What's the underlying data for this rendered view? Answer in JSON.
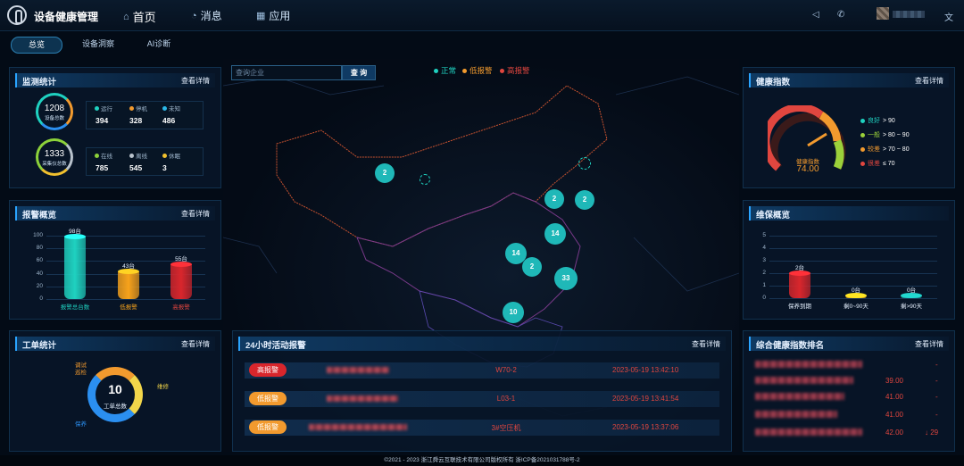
{
  "app": {
    "title": "设备健康管理"
  },
  "topnav": [
    {
      "label": "首页",
      "icon": "home-icon",
      "glyph": "⌂"
    },
    {
      "label": "消息",
      "icon": "message-icon",
      "glyph": "◔"
    },
    {
      "label": "应用",
      "icon": "apps-icon",
      "glyph": "▦"
    }
  ],
  "subtabs": [
    "总览",
    "设备洞察",
    "AI诊断"
  ],
  "monitor": {
    "title": "监测统计",
    "more": "查看详情",
    "device_total": {
      "value": "1208",
      "label": "设备总数"
    },
    "collector_total": {
      "value": "1333",
      "label": "采集仪总数"
    },
    "run_states": [
      {
        "label": "运行",
        "value": "394",
        "color": "#1fd1c0"
      },
      {
        "label": "停机",
        "value": "328",
        "color": "#f29a2e"
      },
      {
        "label": "未知",
        "value": "486",
        "color": "#2bb8e8"
      }
    ],
    "online_states": [
      {
        "label": "在线",
        "value": "785",
        "color": "#8cd13a"
      },
      {
        "label": "离线",
        "value": "545",
        "color": "#b8c2cc"
      },
      {
        "label": "休眠",
        "value": "3",
        "color": "#f2c12e"
      }
    ]
  },
  "alarm_overview": {
    "title": "报警概览",
    "more": "查看详情",
    "y_ticks": [
      "100",
      "80",
      "60",
      "40",
      "20",
      "0"
    ],
    "bars": [
      {
        "label": "报警总台数",
        "value": 98,
        "value_label": "98台",
        "color": "#1fd1c0",
        "label_color": "#1fd1c0"
      },
      {
        "label": "低报警",
        "value": 43,
        "value_label": "43台",
        "color": "#f7a21b",
        "label_color": "#f7a21b"
      },
      {
        "label": "高报警",
        "value": 55,
        "value_label": "55台",
        "color": "#d9262c",
        "label_color": "#e0463f"
      }
    ]
  },
  "workorder": {
    "title": "工单统计",
    "more": "查看详情",
    "center_value": "10",
    "center_label": "工单总数",
    "labels": [
      {
        "text": "调试",
        "color": "#f29a2e"
      },
      {
        "text": "巡检",
        "color": "#f29a2e"
      },
      {
        "text": "维修",
        "color": "#f2d64a"
      },
      {
        "text": "保养",
        "color": "#2b8ff0"
      }
    ]
  },
  "map": {
    "search_placeholder": "查询企业",
    "search_button": "查 询",
    "legend": [
      {
        "label": "正常",
        "color": "#1fd1c0"
      },
      {
        "label": "低报警",
        "color": "#f29a2e"
      },
      {
        "label": "高报警",
        "color": "#e0463f"
      }
    ],
    "clusters": [
      "2",
      "2",
      "2",
      "14",
      "14",
      "2",
      "33",
      "10"
    ]
  },
  "health": {
    "title": "健康指数",
    "more": "查看详情",
    "gauge_label": "健康指数",
    "gauge_value": 74.0,
    "gauge_value_text": "74.00",
    "legend": [
      {
        "level": "良好",
        "range": "> 90",
        "color": "#1fd1c0"
      },
      {
        "level": "一般",
        "range": "> 80 ~ 90",
        "color": "#9bd13a"
      },
      {
        "level": "较差",
        "range": "> 70 ~ 80",
        "color": "#f29a2e"
      },
      {
        "level": "很差",
        "range": "≤ 70",
        "color": "#e0463f"
      }
    ]
  },
  "maintenance": {
    "title": "维保概览",
    "y_ticks": [
      "5",
      "4",
      "3",
      "2",
      "1",
      "0"
    ],
    "bars": [
      {
        "label": "保养到期",
        "value": 2,
        "value_label": "2台",
        "color": "#d9262c"
      },
      {
        "label": "剩0~90天",
        "value": 0,
        "value_label": "0台",
        "color": "#f2b21b"
      },
      {
        "label": "剩>90天",
        "value": 0,
        "value_label": "0台",
        "color": "#1aa6a0"
      }
    ]
  },
  "alarms24h": {
    "title": "24小时活动报警",
    "more": "查看详情",
    "rows": [
      {
        "level": "高报警",
        "color": "#e0463f",
        "code": "W70-2",
        "time": "2023-05-19 13:42:10"
      },
      {
        "level": "低报警",
        "color": "#f29a2e",
        "code": "L03-1",
        "time": "2023-05-19 13:41:54"
      },
      {
        "level": "低报警",
        "color": "#f29a2e",
        "code": "3#空压机",
        "time": "2023-05-19 13:37:06"
      }
    ]
  },
  "ranking": {
    "title": "综合健康指数排名",
    "more": "查看详情",
    "rows": [
      {
        "value": "",
        "trend": "-"
      },
      {
        "value": "39.00",
        "trend": "-"
      },
      {
        "value": "41.00",
        "trend": "-"
      },
      {
        "value": "41.00",
        "trend": "-"
      },
      {
        "value": "42.00",
        "trend": "↓ 29"
      }
    ]
  },
  "footer": {
    "text": "©2021 - 2023    浙江舜云互联技术有限公司版权所有    浙ICP备2021031788号-2"
  }
}
